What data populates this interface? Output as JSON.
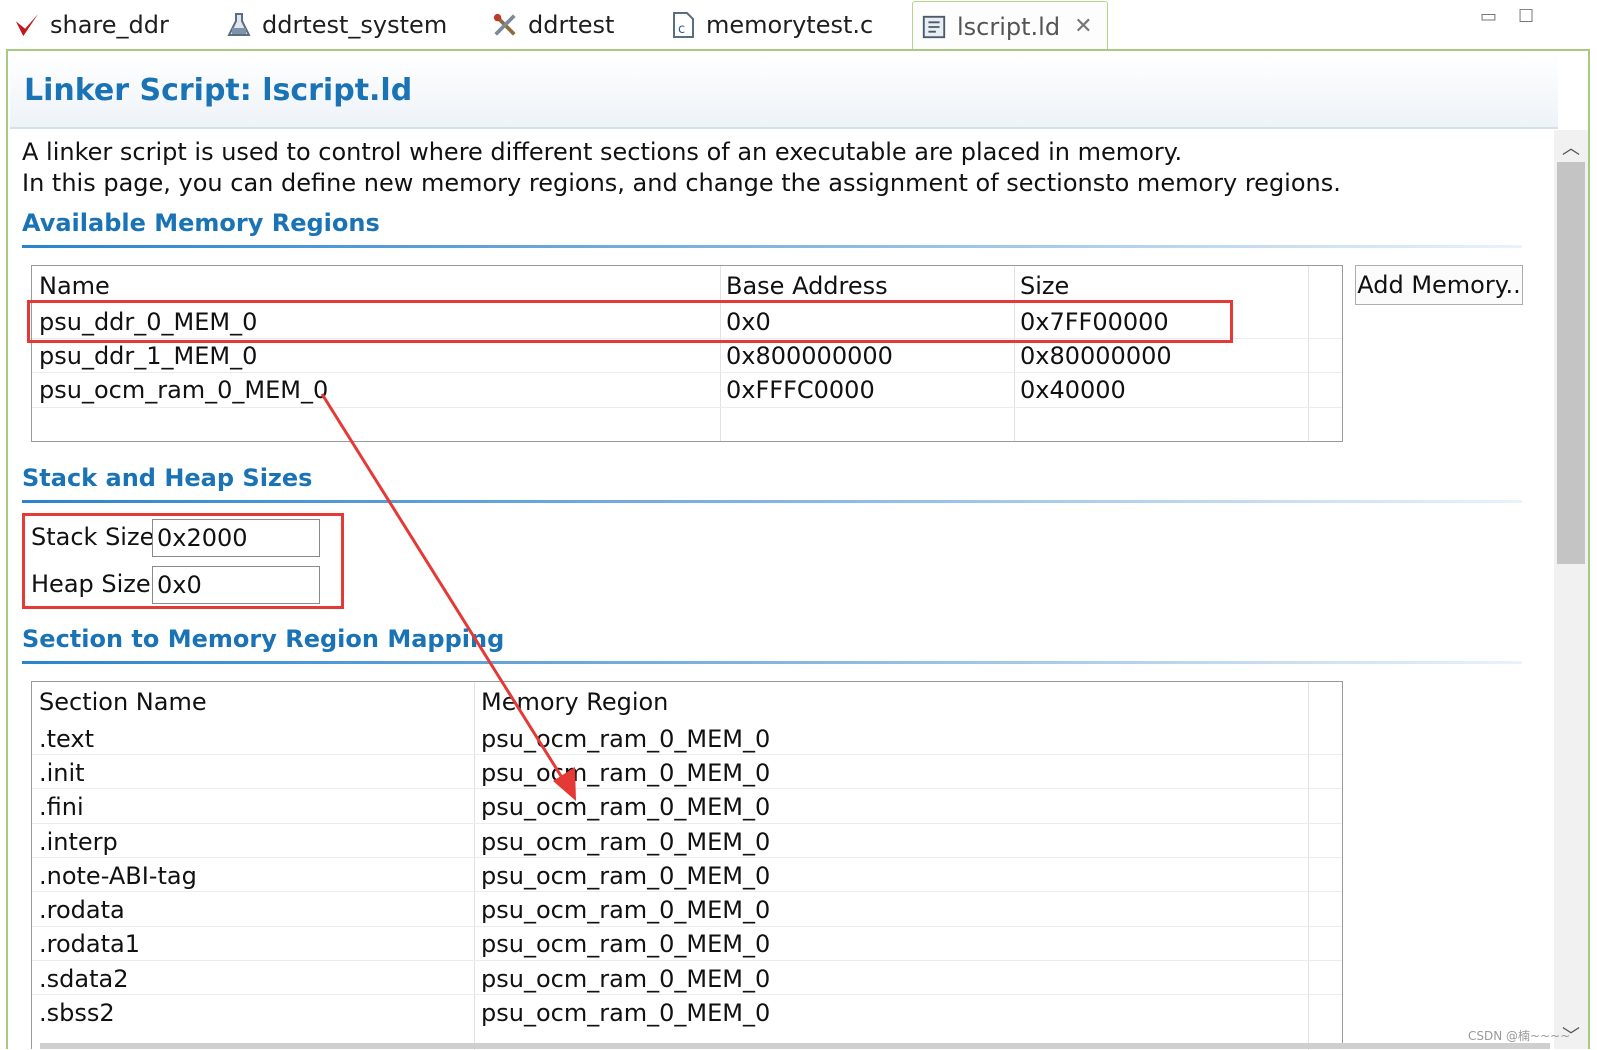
{
  "tabs": [
    {
      "label": "share_ddr",
      "icon": "xilinx-logo-icon"
    },
    {
      "label": "ddrtest_system",
      "icon": "flask-icon"
    },
    {
      "label": "ddrtest",
      "icon": "tools-icon"
    },
    {
      "label": "memorytest.c",
      "icon": "c-file-icon"
    },
    {
      "label": "lscript.ld",
      "icon": "linker-script-icon",
      "active": true
    }
  ],
  "header": {
    "title": "Linker Script: lscript.ld"
  },
  "description": {
    "line1": "A linker script is used to control where different sections of an executable are placed in memory.",
    "line2": "In this page, you can define new memory regions, and change the assignment of sectionsto memory regions."
  },
  "memory_regions": {
    "title": "Available Memory Regions",
    "columns": [
      "Name",
      "Base Address",
      "Size"
    ],
    "rows": [
      [
        "psu_ddr_0_MEM_0",
        "0x0",
        "0x7FF00000"
      ],
      [
        "psu_ddr_1_MEM_0",
        "0x800000000",
        "0x80000000"
      ],
      [
        "psu_ocm_ram_0_MEM_0",
        "0xFFFC0000",
        "0x40000"
      ]
    ],
    "add_button": "Add Memory.."
  },
  "stack_heap": {
    "title": "Stack and Heap Sizes",
    "stack_label": "Stack Size",
    "stack_value": "0x2000",
    "heap_label": "Heap Size",
    "heap_value": "0x0"
  },
  "section_mapping": {
    "title": "Section to Memory Region Mapping",
    "columns": [
      "Section Name",
      "Memory Region"
    ],
    "rows": [
      [
        ".text",
        "psu_ocm_ram_0_MEM_0"
      ],
      [
        ".init",
        "psu_ocm_ram_0_MEM_0"
      ],
      [
        ".fini",
        "psu_ocm_ram_0_MEM_0"
      ],
      [
        ".interp",
        "psu_ocm_ram_0_MEM_0"
      ],
      [
        ".note-ABI-tag",
        "psu_ocm_ram_0_MEM_0"
      ],
      [
        ".rodata",
        "psu_ocm_ram_0_MEM_0"
      ],
      [
        ".rodata1",
        "psu_ocm_ram_0_MEM_0"
      ],
      [
        ".sdata2",
        "psu_ocm_ram_0_MEM_0"
      ],
      [
        ".sbss2",
        "psu_ocm_ram_0_MEM_0"
      ]
    ]
  },
  "annotation_color": "#e53935",
  "accent_color": "#1a73b5",
  "watermark": "CSDN @楠~~~~"
}
